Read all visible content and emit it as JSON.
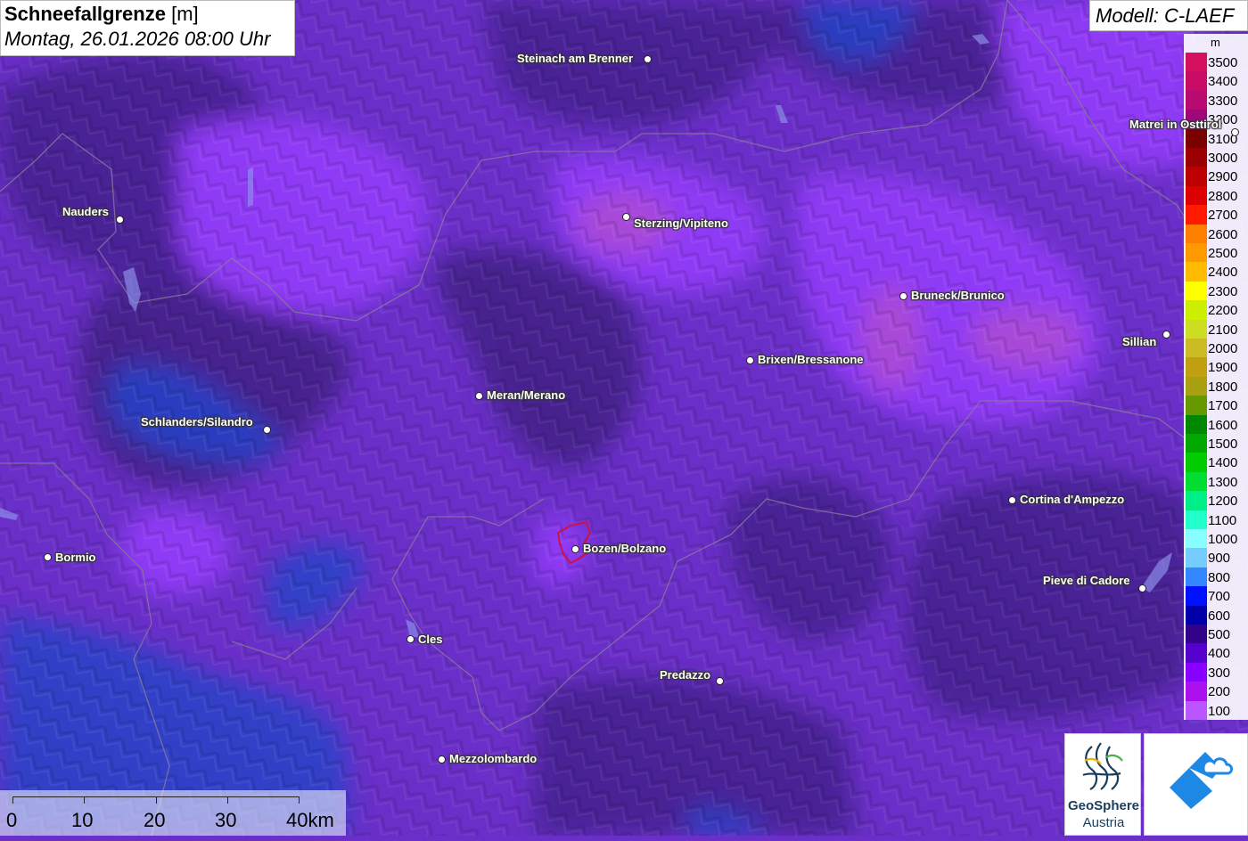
{
  "title": {
    "main": "Schneefallgrenze",
    "unit": "[m]",
    "datetime": "Montag, 26.01.2026 08:00 Uhr"
  },
  "model": "Modell: C-LAEF",
  "legend": {
    "unit": "m",
    "entries": [
      {
        "label": "3500",
        "color": "#d6105e"
      },
      {
        "label": "3400",
        "color": "#c80c66"
      },
      {
        "label": "3300",
        "color": "#b80a70"
      },
      {
        "label": "3200",
        "color": "#9e0878"
      },
      {
        "label": "3100",
        "color": "#7a0000"
      },
      {
        "label": "3000",
        "color": "#9a0000"
      },
      {
        "label": "2900",
        "color": "#bc0000"
      },
      {
        "label": "2800",
        "color": "#dd0000"
      },
      {
        "label": "2700",
        "color": "#ff1a00"
      },
      {
        "label": "2600",
        "color": "#ff7f00"
      },
      {
        "label": "2500",
        "color": "#ff9900"
      },
      {
        "label": "2400",
        "color": "#ffbb00"
      },
      {
        "label": "2300",
        "color": "#ffff00"
      },
      {
        "label": "2200",
        "color": "#ccee00"
      },
      {
        "label": "2100",
        "color": "#ccdd22"
      },
      {
        "label": "2000",
        "color": "#ccbb22"
      },
      {
        "label": "1900",
        "color": "#c0a010"
      },
      {
        "label": "1800",
        "color": "#a8a010"
      },
      {
        "label": "1700",
        "color": "#669900"
      },
      {
        "label": "1600",
        "color": "#008800"
      },
      {
        "label": "1500",
        "color": "#00a800"
      },
      {
        "label": "1400",
        "color": "#00cc00"
      },
      {
        "label": "1300",
        "color": "#00dd33"
      },
      {
        "label": "1200",
        "color": "#00ee88"
      },
      {
        "label": "1100",
        "color": "#22ffcc"
      },
      {
        "label": "1000",
        "color": "#88ffff"
      },
      {
        "label": "900",
        "color": "#77ccff"
      },
      {
        "label": "800",
        "color": "#3388ff"
      },
      {
        "label": "700",
        "color": "#0011ff"
      },
      {
        "label": "600",
        "color": "#0000aa"
      },
      {
        "label": "500",
        "color": "#330088"
      },
      {
        "label": "400",
        "color": "#5500cc"
      },
      {
        "label": "300",
        "color": "#8800ff"
      },
      {
        "label": "200",
        "color": "#aa11ee"
      },
      {
        "label": "100",
        "color": "#bb55ff"
      }
    ]
  },
  "cities": [
    {
      "name": "Steinach am Brenner"
    },
    {
      "name": "Nauders"
    },
    {
      "name": "Sterzing/Vipiteno"
    },
    {
      "name": "Matrei in Osttirol"
    },
    {
      "name": "Bruneck/Brunico"
    },
    {
      "name": "Sillian"
    },
    {
      "name": "Brixen/Bressanone"
    },
    {
      "name": "Meran/Merano"
    },
    {
      "name": "Schlanders/Silandro"
    },
    {
      "name": "Cortina d'Ampezzo"
    },
    {
      "name": "Bormio"
    },
    {
      "name": "Bozen/Bolzano"
    },
    {
      "name": "Pieve di Cadore"
    },
    {
      "name": "Cles"
    },
    {
      "name": "Predazzo"
    },
    {
      "name": "Mezzolombardo"
    }
  ],
  "scale": {
    "labels": [
      "0",
      "10",
      "20",
      "30",
      "40km"
    ]
  },
  "logos": {
    "geosphere_name": "GeoSphere",
    "geosphere_sub": "Austria"
  }
}
